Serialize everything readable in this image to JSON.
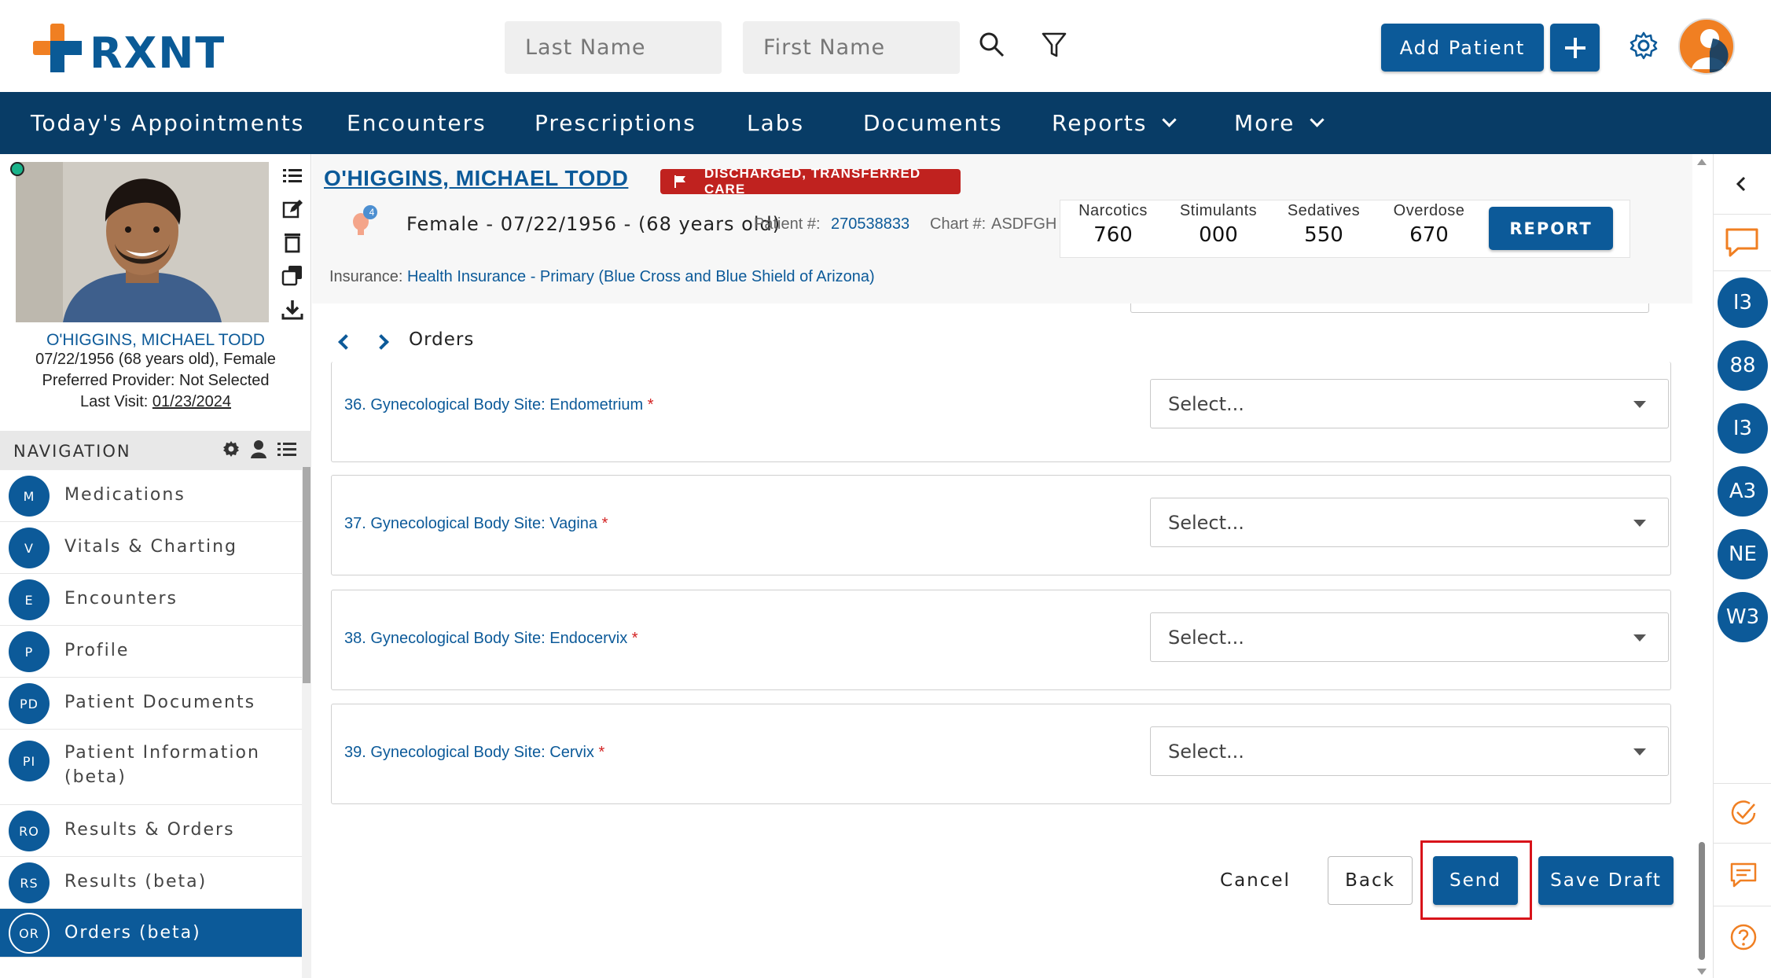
{
  "app": {
    "logo_text": "RXNT"
  },
  "search": {
    "last_name_placeholder": "Last Name",
    "first_name_placeholder": "First Name"
  },
  "header": {
    "add_patient_label": "Add Patient"
  },
  "nav": {
    "items": [
      "Today's Appointments",
      "Encounters",
      "Prescriptions",
      "Labs",
      "Documents",
      "Reports",
      "More"
    ]
  },
  "patient": {
    "name": "O'HIGGINS, MICHAEL TODD",
    "dob_line": "07/22/1956 (68 years old), Female",
    "preferred_provider": "Preferred Provider: Not Selected",
    "last_visit_label": "Last Visit:",
    "last_visit_date": "01/23/2024",
    "status_badge": "DISCHARGED, TRANSFERRED CARE",
    "demographics": "Female - 07/22/1956 - (68 years old)",
    "patient_num_label": "Patient #:",
    "patient_num": "270538833",
    "chart_num_label": "Chart #:",
    "chart_num": "ASDFGH",
    "alerts_count": "4",
    "insurance_label": "Insurance:",
    "insurance_value": "Health Insurance - Primary (Blue Cross and Blue Shield of Arizona)"
  },
  "stats": {
    "items": [
      {
        "label": "Narcotics",
        "value": "760"
      },
      {
        "label": "Stimulants",
        "value": "000"
      },
      {
        "label": "Sedatives",
        "value": "550"
      },
      {
        "label": "Overdose",
        "value": "670"
      }
    ],
    "report_label": "REPORT"
  },
  "side_nav": {
    "header": "NAVIGATION",
    "items": [
      {
        "abbr": "M",
        "label": "Medications"
      },
      {
        "abbr": "V",
        "label": "Vitals & Charting"
      },
      {
        "abbr": "E",
        "label": "Encounters"
      },
      {
        "abbr": "P",
        "label": "Profile"
      },
      {
        "abbr": "PD",
        "label": "Patient Documents"
      },
      {
        "abbr": "PI",
        "label": "Patient Information (beta)"
      },
      {
        "abbr": "RO",
        "label": "Results & Orders"
      },
      {
        "abbr": "RS",
        "label": "Results (beta)"
      },
      {
        "abbr": "OR",
        "label": "Orders (beta)"
      }
    ]
  },
  "orders": {
    "title": "Orders",
    "questions": [
      {
        "label": "36. Gynecological Body Site: Endometrium",
        "value": "Select..."
      },
      {
        "label": "37. Gynecological Body Site: Vagina",
        "value": "Select..."
      },
      {
        "label": "38. Gynecological Body Site: Endocervix",
        "value": "Select..."
      },
      {
        "label": "39. Gynecological Body Site: Cervix",
        "value": "Select..."
      }
    ],
    "required_mark": "*",
    "cancel_label": "Cancel",
    "back_label": "Back",
    "send_label": "Send",
    "save_draft_label": "Save Draft"
  },
  "right_rail": {
    "avatars": [
      "I3",
      "88",
      "I3",
      "A3",
      "NE",
      "W3"
    ]
  },
  "colors": {
    "brand_blue": "#0c5a99",
    "nav_dark": "#083c66",
    "orange": "#f07f22",
    "danger": "#c0221f"
  }
}
